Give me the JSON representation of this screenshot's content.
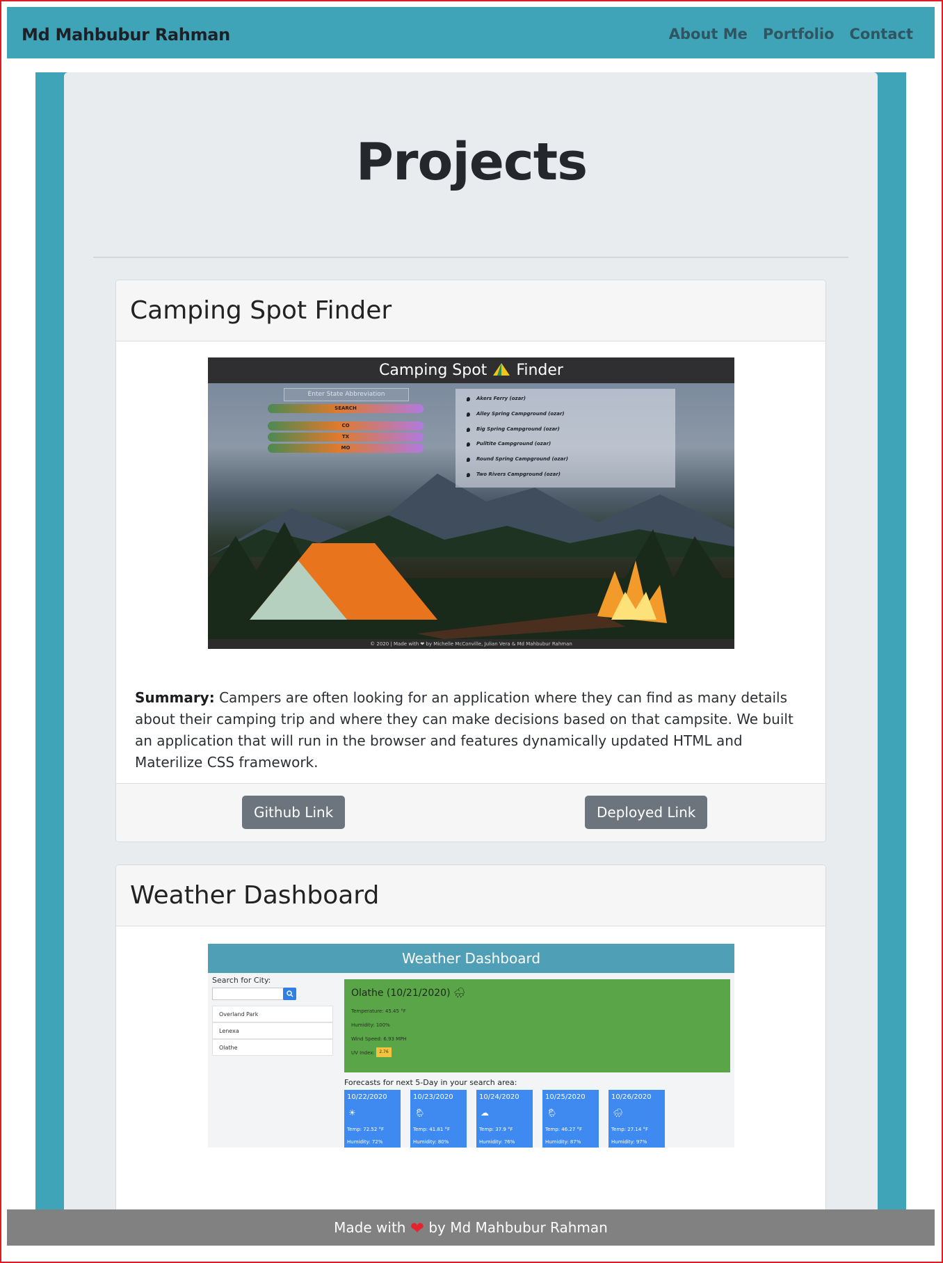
{
  "navbar": {
    "brand": "Md Mahbubur Rahman",
    "links": [
      "About Me",
      "Portfolio",
      "Contact"
    ]
  },
  "page_title": "Projects",
  "projects": [
    {
      "title": "Camping Spot Finder",
      "summary_label": "Summary:",
      "summary": "Campers are often looking for an application where they can find as many details about their camping trip and where they can make decisions based on that campsite. We built an application that will run in the browser and features dynamically updated HTML and Materilize CSS framework.",
      "github_label": "Github Link",
      "deployed_label": "Deployed Link",
      "screenshot": {
        "title_left": "Camping Spot",
        "title_right": "Finder",
        "input_placeholder": "Enter State Abbreviation",
        "buttons": [
          "SEARCH",
          "CO",
          "TX",
          "MO"
        ],
        "campgrounds": [
          "Akers Ferry (ozar)",
          "Alley Spring Campground (ozar)",
          "Big Spring Campground (ozar)",
          "Pulltite Campground (ozar)",
          "Round Spring Campground (ozar)",
          "Two Rivers Campground (ozar)"
        ],
        "footer": "© 2020 | Made with ❤ by Michelle McConville, Julian Vera & Md Mahbubur Rahman"
      }
    },
    {
      "title": "Weather Dashboard",
      "screenshot": {
        "header": "Weather Dashboard",
        "search_label": "Search for City:",
        "search_icon": "magnifier",
        "cities": [
          "Overland Park",
          "Lenexa",
          "Olathe"
        ],
        "current_title": "Olathe (10/21/2020)",
        "current_icon": "🌧",
        "temperature": "Temperature: 45.45 °F",
        "humidity": "Humidity: 100%",
        "wind": "Wind Speed: 6.93 MPH",
        "uv_label": "UV Index:",
        "uv_value": "2.76",
        "forecast_heading": "Forecasts for next 5-Day in your search area:",
        "forecast": [
          {
            "date": "10/22/2020",
            "icon": "☀",
            "temp": "Temp: 72.52 °F",
            "humidity": "Humidity: 72%"
          },
          {
            "date": "10/23/2020",
            "icon": "🌦",
            "temp": "Temp: 41.81 °F",
            "humidity": "Humidity: 80%"
          },
          {
            "date": "10/24/2020",
            "icon": "☁",
            "temp": "Temp: 37.9 °F",
            "humidity": "Humidity: 76%"
          },
          {
            "date": "10/25/2020",
            "icon": "🌦",
            "temp": "Temp: 46.27 °F",
            "humidity": "Humidity: 87%"
          },
          {
            "date": "10/26/2020",
            "icon": "🌧",
            "temp": "Temp: 27.14 °F",
            "humidity": "Humidity: 97%"
          }
        ]
      }
    }
  ],
  "footer": {
    "before": "Made with",
    "heart": "❤",
    "after": "by Md Mahbubur Rahman"
  },
  "colors": {
    "navbar": "#40a4b8",
    "jumbotron": "#e9ecef",
    "button": "#6c757d",
    "footer": "#818181"
  }
}
